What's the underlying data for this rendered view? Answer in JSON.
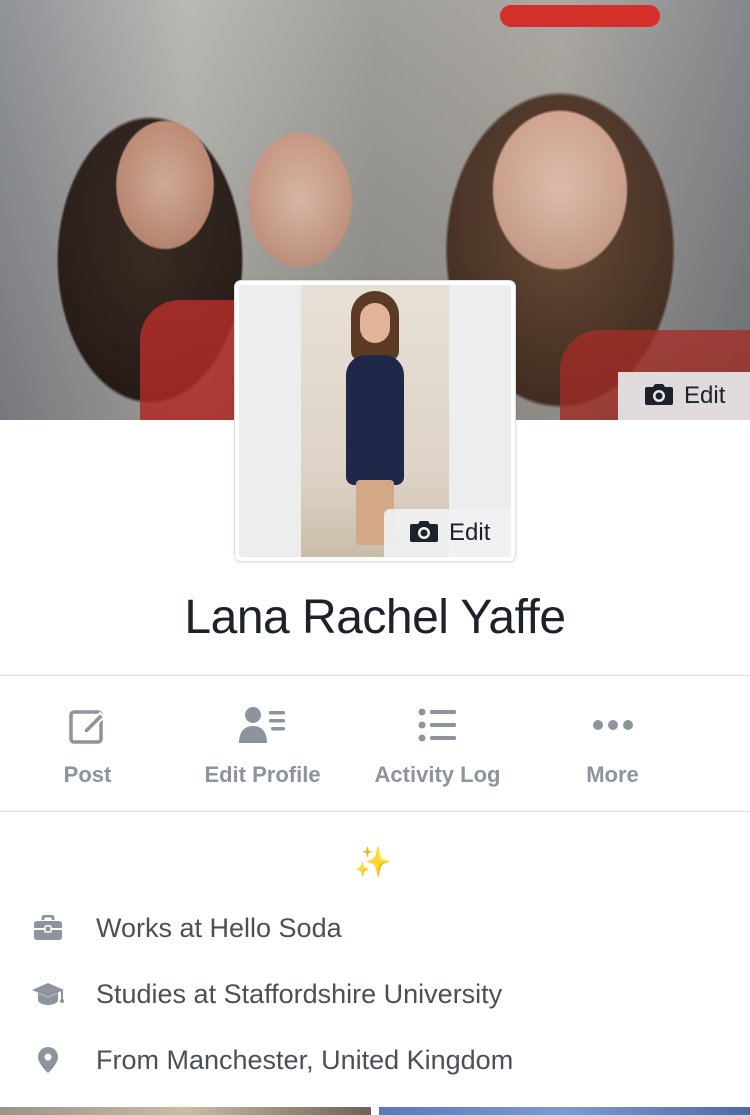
{
  "cover": {
    "edit_label": "Edit"
  },
  "profile_picture": {
    "edit_label": "Edit"
  },
  "profile": {
    "name": "Lana Rachel Yaffe",
    "bio_emoji": "✨"
  },
  "actions": [
    {
      "label": "Post",
      "icon": "compose-icon"
    },
    {
      "label": "Edit Profile",
      "icon": "person-list-icon"
    },
    {
      "label": "Activity Log",
      "icon": "list-icon"
    },
    {
      "label": "More",
      "icon": "more-dots-icon"
    }
  ],
  "intro": [
    {
      "icon": "briefcase-icon",
      "text": "Works at Hello Soda"
    },
    {
      "icon": "graduation-cap-icon",
      "text": "Studies at Staffordshire University"
    },
    {
      "icon": "location-pin-icon",
      "text": "From Manchester, United Kingdom"
    }
  ],
  "colors": {
    "text_primary": "#1d2129",
    "text_secondary": "#4b4f56",
    "action_gray": "#8d949e",
    "divider": "#dadde1"
  }
}
